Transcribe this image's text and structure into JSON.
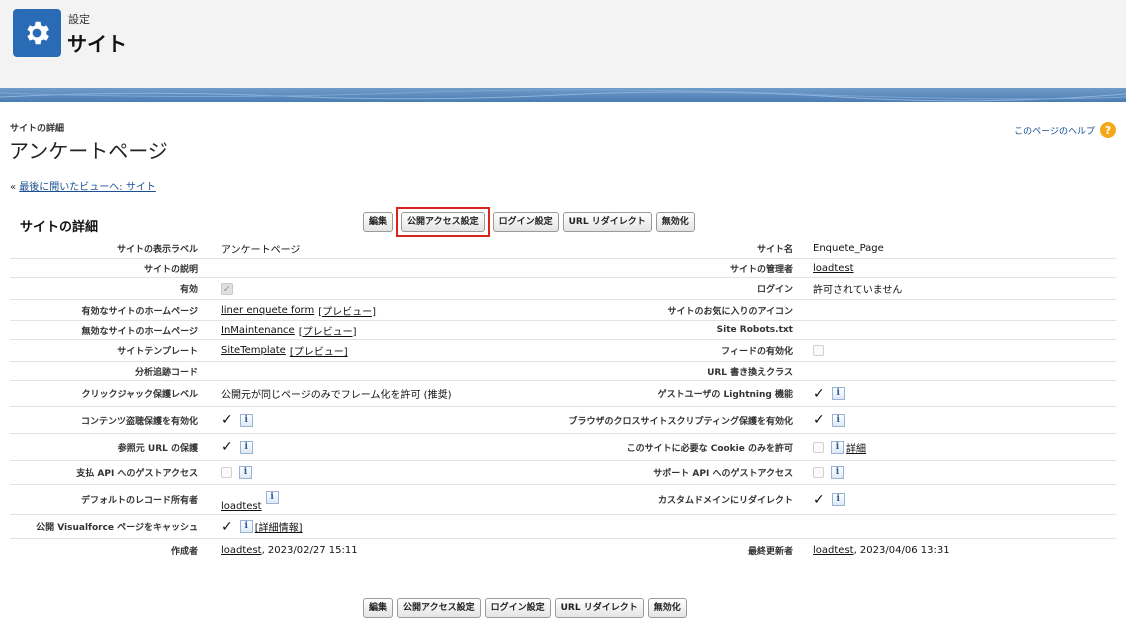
{
  "header": {
    "small_label": "設定",
    "title": "サイト",
    "gear_icon": "gear-icon"
  },
  "page": {
    "small_label": "サイトの詳細",
    "title": "アンケートページ",
    "help_link": "このページのヘルプ",
    "help_icon": "?",
    "back_prefix": "« ",
    "back_link": "最後に開いたビューへ: サイト"
  },
  "section_title": "サイトの詳細",
  "buttons": {
    "edit": "編集",
    "public_access": "公開アクセス設定",
    "login_settings": "ログイン設定",
    "url_redirect": "URL リダイレクト",
    "deactivate": "無効化"
  },
  "fields": {
    "site_label": {
      "label": "サイトの表示ラベル",
      "value": "アンケートページ"
    },
    "site_name": {
      "label": "サイト名",
      "value": "Enquete_Page"
    },
    "site_description": {
      "label": "サイトの説明",
      "value": ""
    },
    "site_admin": {
      "label": "サイトの管理者",
      "value": "loadtest"
    },
    "active": {
      "label": "有効",
      "checked": true
    },
    "login": {
      "label": "ログイン",
      "value": "許可されていません"
    },
    "active_home": {
      "label": "有効なサイトのホームページ",
      "value": "liner enquete form",
      "preview": "[プレビュー]"
    },
    "favorite_icon": {
      "label": "サイトのお気に入りのアイコン",
      "value": ""
    },
    "inactive_home": {
      "label": "無効なサイトのホームページ",
      "value": "InMaintenance",
      "preview": "[プレビュー]"
    },
    "robots": {
      "label": "Site Robots.txt",
      "value": ""
    },
    "template": {
      "label": "サイトテンプレート",
      "value": "SiteTemplate",
      "preview": "[プレビュー]"
    },
    "feeds": {
      "label": "フィードの有効化",
      "checked": false
    },
    "analytics": {
      "label": "分析追跡コード",
      "value": ""
    },
    "url_rewrite": {
      "label": "URL 書き換えクラス",
      "value": ""
    },
    "clickjack": {
      "label": "クリックジャック保護レベル",
      "value": "公開元が同じページのみでフレーム化を許可 (推奨)"
    },
    "guest_lightning": {
      "label": "ゲストユーザの Lightning 機能",
      "checked": true
    },
    "content_sniffing": {
      "label": "コンテンツ盗聴保護を有効化",
      "checked": true
    },
    "xss": {
      "label": "ブラウザのクロスサイトスクリプティング保護を有効化",
      "checked": true
    },
    "referrer": {
      "label": "参照元 URL の保護",
      "checked": true
    },
    "cookies": {
      "label": "このサイトに必要な Cookie のみを許可",
      "checked": false,
      "detail": "詳細"
    },
    "payments_api": {
      "label": "支払 API へのゲストアクセス",
      "checked": false
    },
    "support_api": {
      "label": "サポート API へのゲストアクセス",
      "checked": false
    },
    "default_owner": {
      "label": "デフォルトのレコード所有者",
      "value": "loadtest"
    },
    "custom_domain": {
      "label": "カスタムドメインにリダイレクト",
      "checked": true
    },
    "cache_vf": {
      "label": "公開 Visualforce ページをキャッシュ",
      "checked": true,
      "detail": "[詳細情報]"
    },
    "created_by": {
      "label": "作成者",
      "user": "loadtest",
      "date": ", 2023/02/27 15:11"
    },
    "modified_by": {
      "label": "最終更新者",
      "user": "loadtest",
      "date": ", 2023/04/06 13:31"
    }
  },
  "icons": {
    "check": "✓",
    "info": "i"
  },
  "colors": {
    "header_bg": "#f3f3f3",
    "gear_tile": "#2a6bb5",
    "band": "#5a88bd",
    "highlight": "#d9261c",
    "help": "#f3a81c"
  }
}
